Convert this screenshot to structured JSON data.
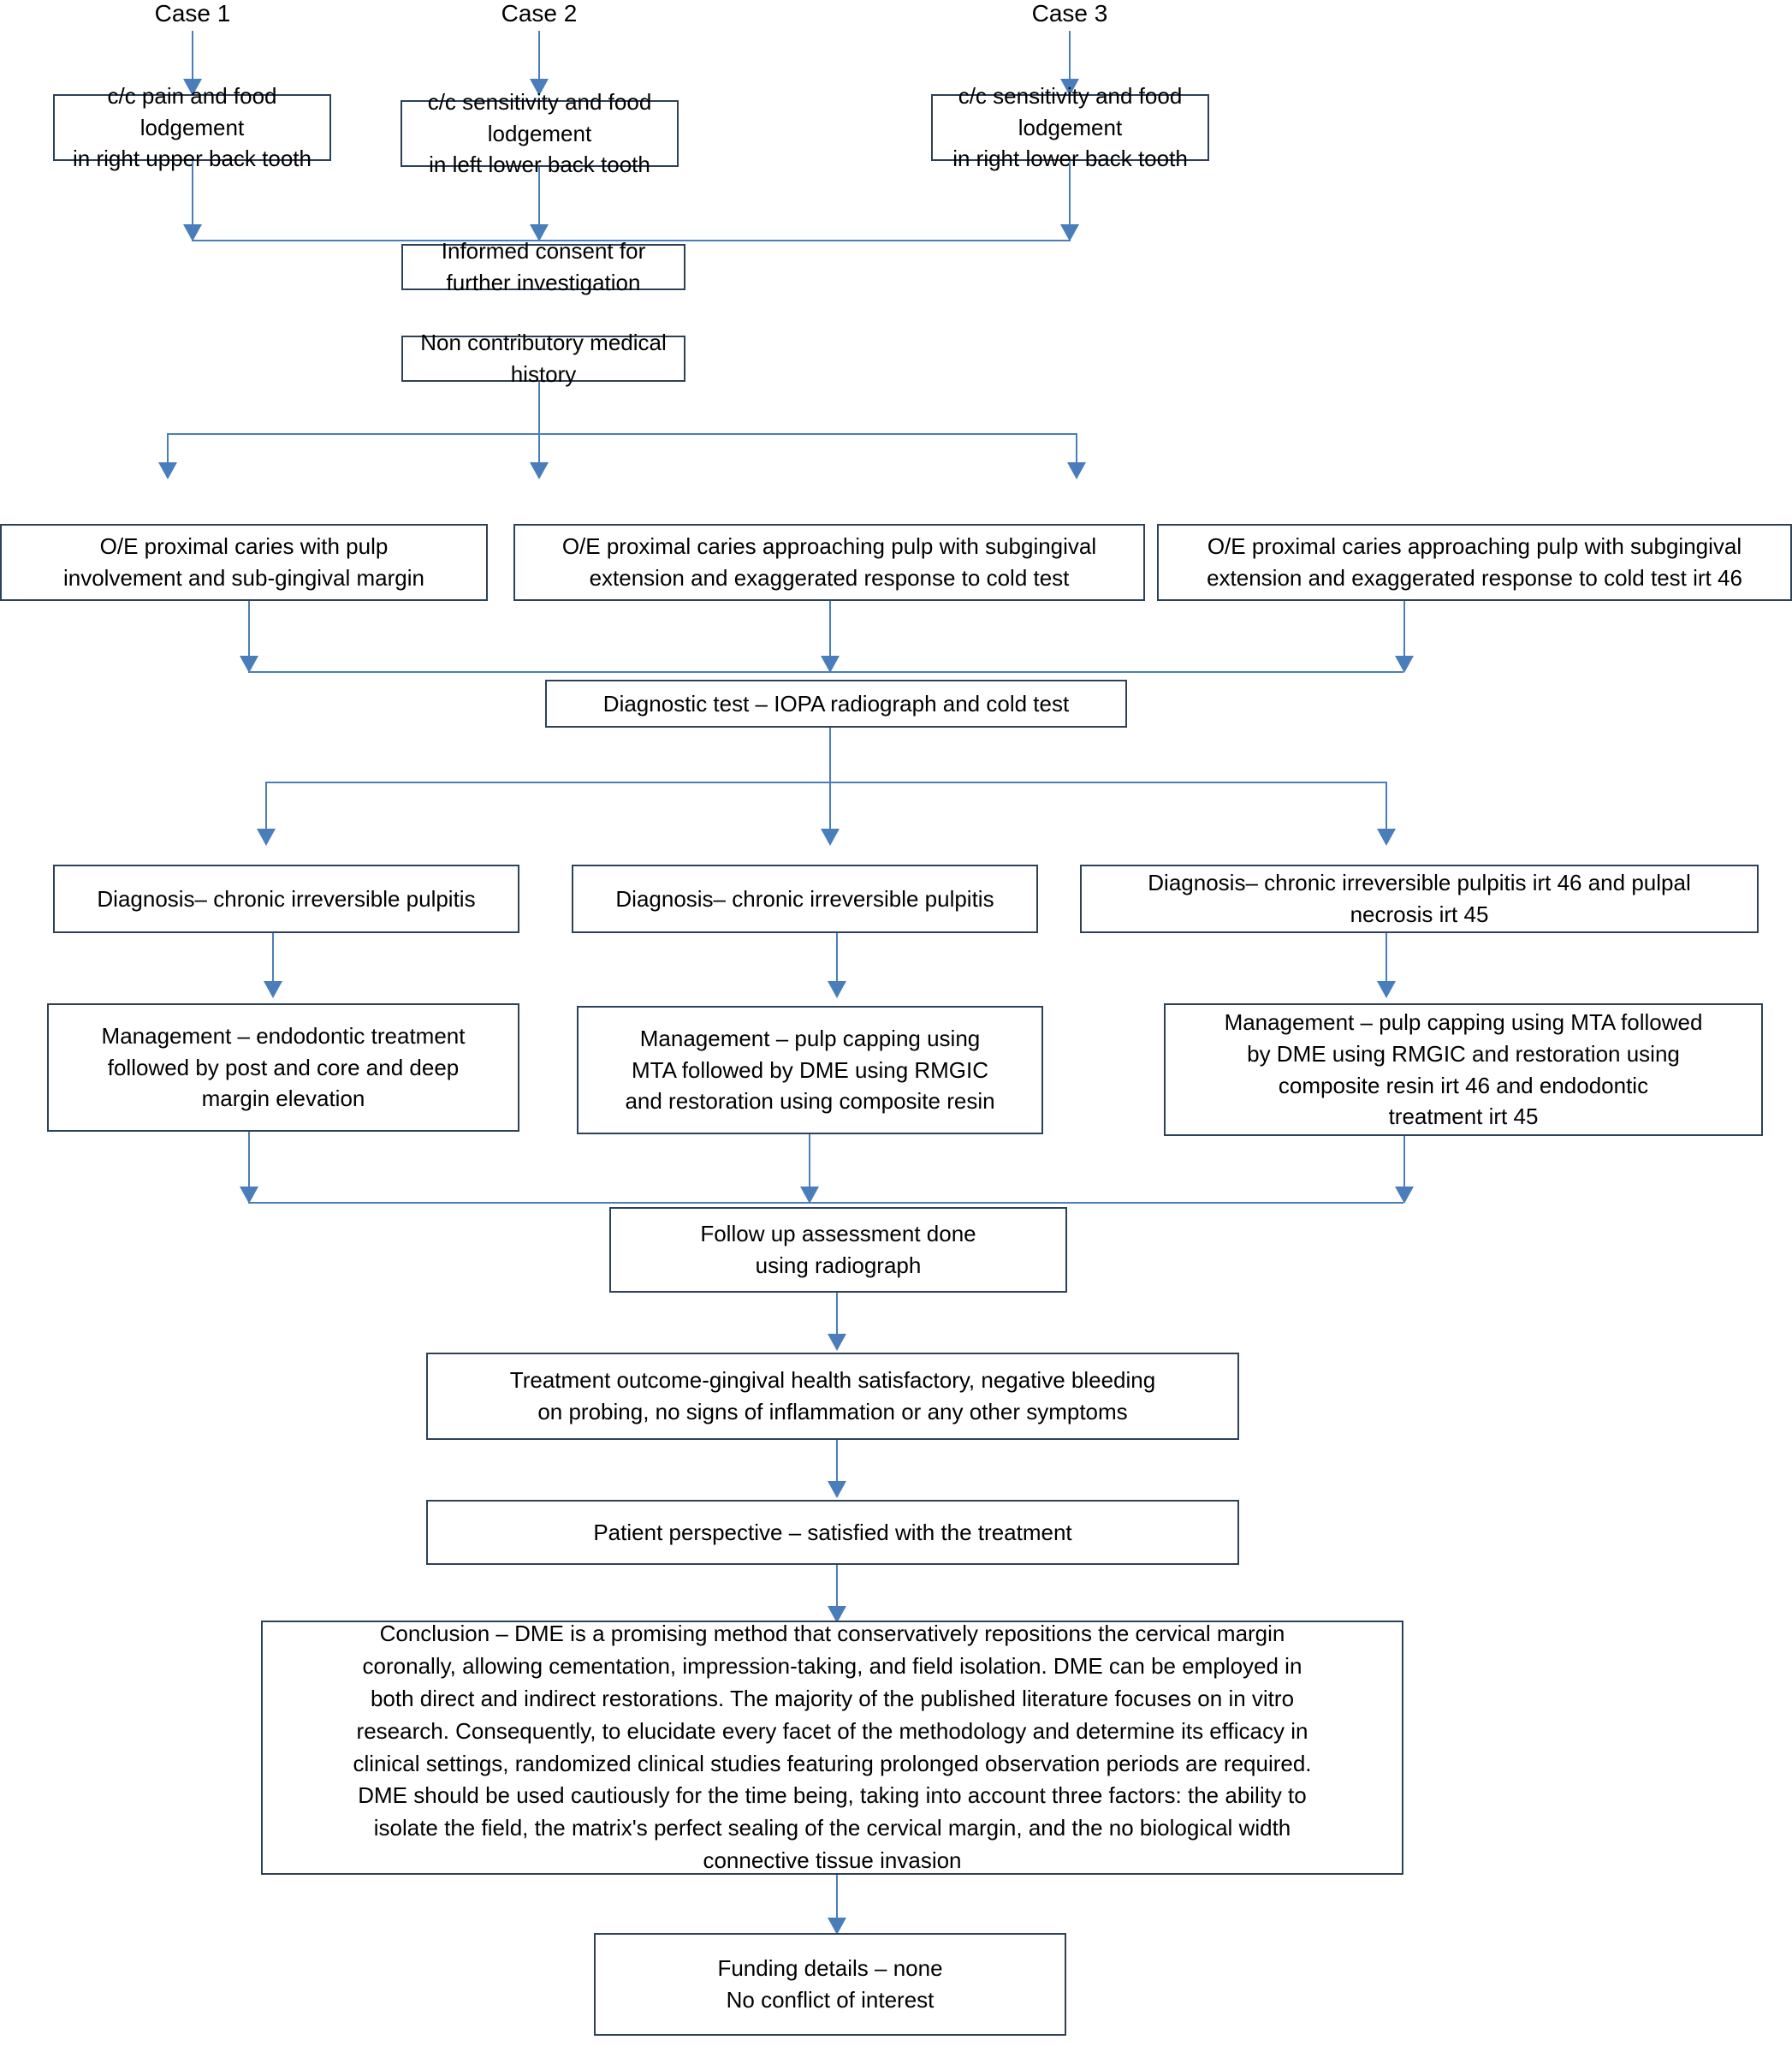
{
  "diagram": {
    "title": "Deep margin elevation (DME) three-case clinical flowchart",
    "colors": {
      "box_border": "#2d4159",
      "connector": "#4a7ebb",
      "background": "#ffffff",
      "text": "#000000"
    },
    "case_labels": [
      {
        "id": "case-1",
        "text": "Case 1"
      },
      {
        "id": "case-2",
        "text": "Case 2"
      },
      {
        "id": "case-3",
        "text": "Case 3"
      }
    ],
    "nodes": {
      "chief_complaint": [
        {
          "id": "cc-case-1",
          "text": "c/c pain and food lodgement\nin right upper back tooth"
        },
        {
          "id": "cc-case-2",
          "text": "c/c sensitivity and food lodgement\nin left lower back tooth"
        },
        {
          "id": "cc-case-3",
          "text": "c/c sensitivity and food lodgement\nin right lower back tooth"
        }
      ],
      "consent": "Informed consent for further investigation",
      "medical_history": "Non contributory medical history",
      "examination": [
        {
          "id": "oe-case-1",
          "text": "O/E proximal caries with pulp\ninvolvement and sub-gingival margin"
        },
        {
          "id": "oe-case-2",
          "text": "O/E proximal caries approaching pulp with subgingival\nextension and exaggerated response to cold test"
        },
        {
          "id": "oe-case-3",
          "text": "O/E proximal caries approaching pulp with subgingival\nextension and exaggerated response to cold test irt 46"
        }
      ],
      "diagnostic_test": "Diagnostic test – IOPA radiograph and cold test",
      "diagnosis": [
        {
          "id": "dx-case-1",
          "text": "Diagnosis– chronic irreversible pulpitis"
        },
        {
          "id": "dx-case-2",
          "text": "Diagnosis– chronic irreversible pulpitis"
        },
        {
          "id": "dx-case-3",
          "text": "Diagnosis– chronic irreversible pulpitis irt 46 and pulpal\nnecrosis irt 45"
        }
      ],
      "management": [
        {
          "id": "mg-case-1",
          "text": "Management – endodontic treatment\nfollowed by post and core and deep\nmargin elevation"
        },
        {
          "id": "mg-case-2",
          "text": "Management – pulp capping using\nMTA followed by DME using RMGIC\nand restoration using composite resin"
        },
        {
          "id": "mg-case-3",
          "text": "Management – pulp capping using MTA followed\nby DME using RMGIC and restoration using\ncomposite resin irt 46 and endodontic\ntreatment irt 45"
        }
      ],
      "follow_up": "Follow up assessment done\nusing radiograph",
      "treatment_outcome": "Treatment outcome-gingival health satisfactory, negative bleeding\non probing, no signs of inflammation or any other symptoms",
      "patient_perspective": "Patient perspective – satisfied with the treatment",
      "conclusion": "Conclusion – DME is a promising method that conservatively repositions the cervical margin\ncoronally, allowing cementation, impression-taking, and field isolation. DME can be employed in\nboth direct and indirect restorations. The majority of the published literature focuses on in vitro\nresearch. Consequently, to elucidate every facet of the methodology and determine its efficacy in\nclinical settings, randomized clinical studies featuring prolonged observation periods are required.\nDME should be used cautiously for the time being, taking into account three factors: the ability to\nisolate the field, the matrix's perfect sealing of the cervical margin, and the no biological width\nconnective tissue invasion",
      "funding": "Funding details – none\nNo conflict of interest"
    }
  }
}
